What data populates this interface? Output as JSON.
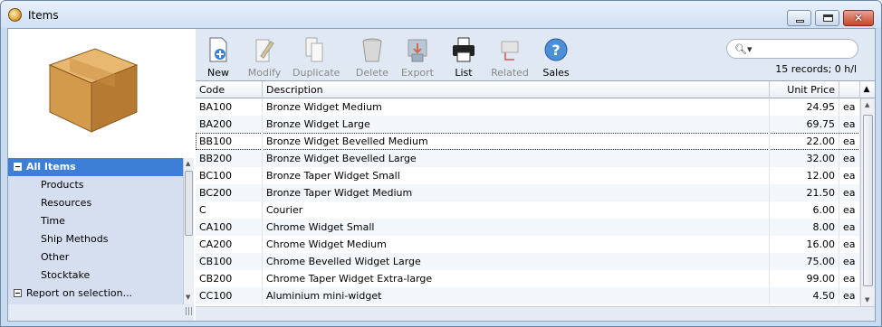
{
  "window": {
    "title": "Items"
  },
  "sidebar": {
    "items": [
      {
        "label": "All Items",
        "selected": true
      },
      {
        "label": "Products"
      },
      {
        "label": "Resources"
      },
      {
        "label": "Time"
      },
      {
        "label": "Ship Methods"
      },
      {
        "label": "Other"
      },
      {
        "label": "Stocktake"
      },
      {
        "label": "Report on selection..."
      }
    ]
  },
  "toolbar": {
    "buttons": [
      {
        "label": "New",
        "icon": "new-document-icon",
        "enabled": true
      },
      {
        "label": "Modify",
        "icon": "modify-pencil-icon",
        "enabled": false
      },
      {
        "label": "Duplicate",
        "icon": "duplicate-icon",
        "enabled": false
      },
      {
        "label": "Delete",
        "icon": "trash-icon",
        "enabled": false
      },
      {
        "label": "Export",
        "icon": "export-icon",
        "enabled": false
      },
      {
        "label": "List",
        "icon": "printer-icon",
        "enabled": true
      },
      {
        "label": "Related",
        "icon": "related-icon",
        "enabled": false
      },
      {
        "label": "Sales",
        "icon": "help-question-icon",
        "enabled": true
      }
    ],
    "search": {
      "value": ""
    },
    "status": "15 records; 0 h/l"
  },
  "table": {
    "columns": [
      "Code",
      "Description",
      "Unit Price",
      ""
    ],
    "rows": [
      [
        "BA100",
        "Bronze Widget Medium",
        "24.95",
        "ea"
      ],
      [
        "BA200",
        "Bronze Widget Large",
        "69.75",
        "ea"
      ],
      [
        "BB100",
        "Bronze Widget Bevelled Medium",
        "22.00",
        "ea"
      ],
      [
        "BB200",
        "Bronze Widget Bevelled Large",
        "32.00",
        "ea"
      ],
      [
        "BC100",
        "Bronze Taper Widget Small",
        "12.00",
        "ea"
      ],
      [
        "BC200",
        "Bronze Taper Widget Medium",
        "21.50",
        "ea"
      ],
      [
        "C",
        "Courier",
        "6.00",
        "ea"
      ],
      [
        "CA100",
        "Chrome Widget Small",
        "8.00",
        "ea"
      ],
      [
        "CA200",
        "Chrome Widget Medium",
        "16.00",
        "ea"
      ],
      [
        "CB100",
        "Chrome Bevelled Widget Large",
        "75.00",
        "ea"
      ],
      [
        "CB200",
        "Chrome Taper Widget Extra-large",
        "99.00",
        "ea"
      ],
      [
        "CC100",
        "Aluminium mini-widget",
        "4.50",
        "ea"
      ]
    ]
  }
}
